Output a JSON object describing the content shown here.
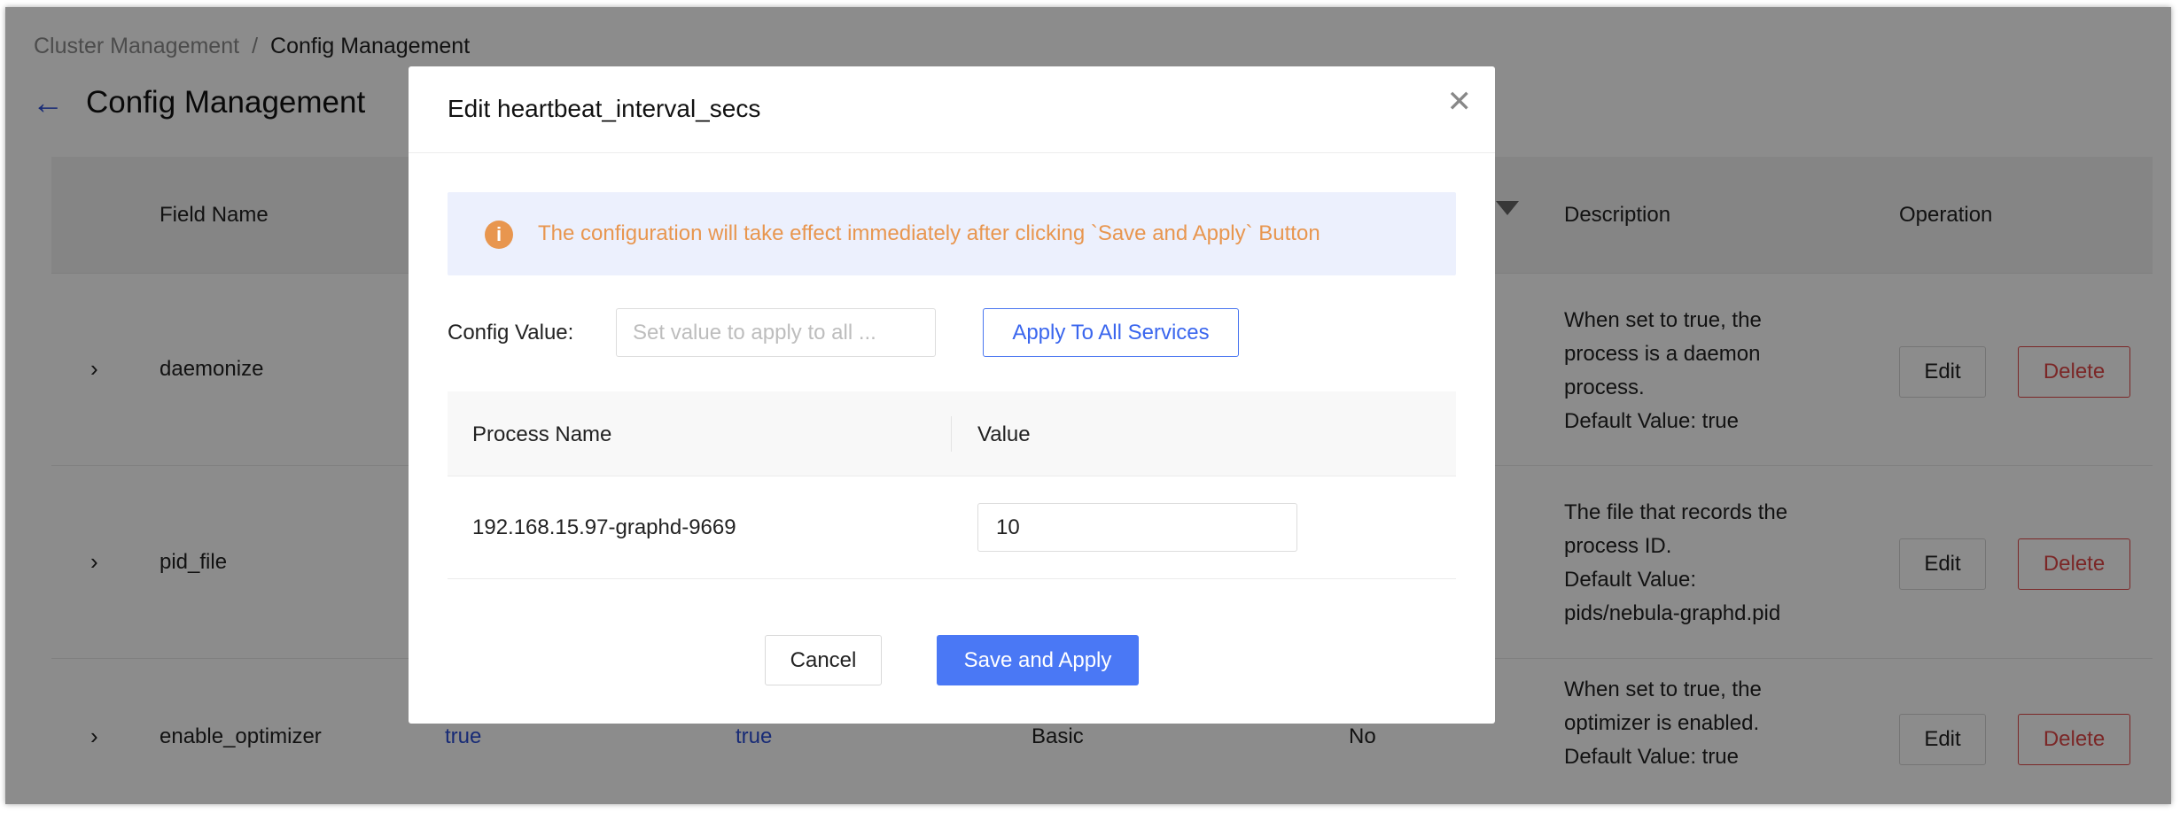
{
  "breadcrumb": {
    "parent": "Cluster Management",
    "separator": "/",
    "current": "Config Management"
  },
  "page": {
    "title": "Config Management",
    "back_icon": "arrow-left-icon"
  },
  "table": {
    "headers": {
      "field_name": "Field Name",
      "description": "Description",
      "operation": "Operation"
    },
    "rows": [
      {
        "field": "daemonize",
        "desc": [
          "When set to true, the",
          "process is a daemon",
          "process.",
          "Default Value: true"
        ],
        "edit": "Edit",
        "delete": "Delete"
      },
      {
        "field": "pid_file",
        "desc": [
          "The file that records the",
          "process ID.",
          "Default Value:",
          "pids/nebula-graphd.pid"
        ],
        "edit": "Edit",
        "delete": "Delete"
      },
      {
        "field": "enable_optimizer",
        "value1": "true",
        "value2": "true",
        "category": "Basic",
        "flag": "No",
        "desc": [
          "When set to true, the",
          "optimizer is enabled.",
          "Default Value: true"
        ],
        "edit": "Edit",
        "delete": "Delete"
      }
    ]
  },
  "modal": {
    "title": "Edit heartbeat_interval_secs",
    "alert": "The configuration will take effect immediately after clicking `Save and Apply` Button",
    "config_label": "Config Value",
    "config_colon": ":",
    "config_placeholder": "Set value to apply to all ...",
    "apply_all": "Apply To All Services",
    "columns": {
      "process": "Process Name",
      "value": "Value"
    },
    "processes": [
      {
        "name": "192.168.15.97-graphd-9669",
        "value": "10"
      }
    ],
    "cancel": "Cancel",
    "save": "Save and Apply"
  },
  "colors": {
    "accent": "#4a78f5",
    "warning": "#e8964f",
    "danger": "#e04848",
    "alert_bg": "#ecf0fd"
  }
}
